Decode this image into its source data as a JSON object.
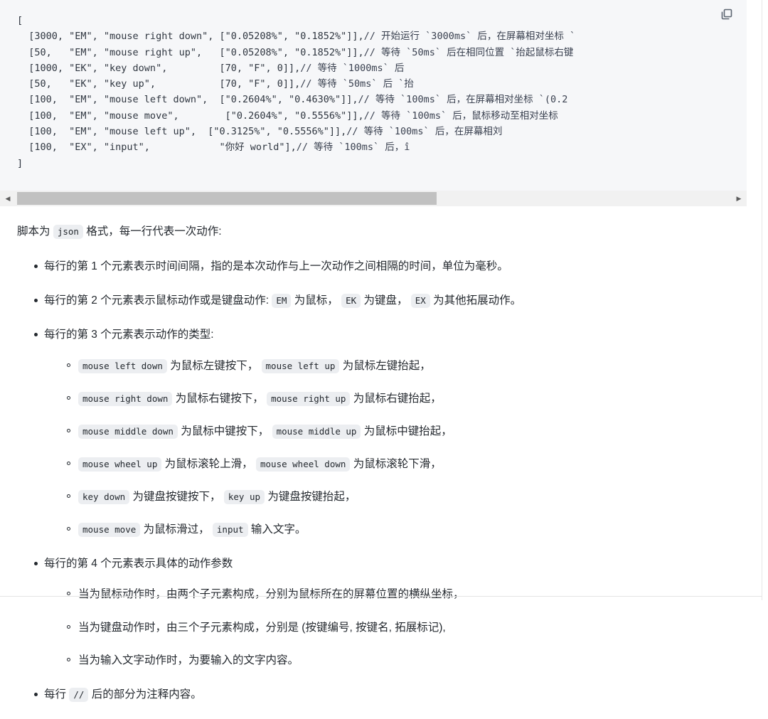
{
  "code_block": {
    "copy_icon": "copy-icon",
    "language": "json",
    "lines": [
      {
        "code": "[",
        "comment": ""
      },
      {
        "code": "  [3000, \"EM\", \"mouse right down\", [\"0.05208%\", \"0.1852%\"]],",
        "comment": "// 开始运行 `3000ms` 后，在屏幕相对坐标 `"
      },
      {
        "code": "  [50,   \"EM\", \"mouse right up\",   [\"0.05208%\", \"0.1852%\"]],",
        "comment": "// 等待 `50ms` 后在相同位置 `抬起鼠标右键"
      },
      {
        "code": "  [1000, \"EK\", \"key down\",         [70, \"F\", 0]],",
        "comment": "// 等待 `1000ms` 后 "
      },
      {
        "code": "  [50,   \"EK\", \"key up\",           [70, \"F\", 0]],",
        "comment": "// 等待 `50ms` 后 `抬"
      },
      {
        "code": "  [100,  \"EM\", \"mouse left down\",  [\"0.2604%\", \"0.4630%\"]],",
        "comment": "// 等待 `100ms` 后，在屏幕相对坐标 `(0.2"
      },
      {
        "code": "  [100,  \"EM\", \"mouse move\",        [\"0.2604%\", \"0.5556%\"]],",
        "comment": "// 等待 `100ms` 后，鼠标移动至相对坐标"
      },
      {
        "code": "  [100,  \"EM\", \"mouse left up\",  [\"0.3125%\", \"0.5556%\"]],",
        "comment": "// 等待 `100ms` 后，在屏幕相刘"
      },
      {
        "code": "  [100,  \"EX\", \"input\",            \"你好 world\"],",
        "comment": "// 等待 `100ms` 后，î"
      },
      {
        "code": "]",
        "comment": ""
      }
    ],
    "scrollbar": {
      "left_arrow": "◀",
      "right_arrow": "▶"
    }
  },
  "prose": {
    "intro": {
      "before": "脚本为",
      "code": "json",
      "after": "格式，每一行代表一次动作:"
    },
    "bullets": {
      "b1": "每行的第 1 个元素表示时间间隔，指的是本次动作与上一次动作之间相隔的时间，单位为毫秒。",
      "b2": {
        "lead": "每行的第 2 个元素表示鼠标动作或是键盘动作:",
        "c1": "EM",
        "t1": "为鼠标，",
        "c2": "EK",
        "t2": "为键盘，",
        "c3": "EX",
        "t3": "为其他拓展动作。"
      },
      "b3": {
        "lead": "每行的第 3 个元素表示动作的类型:",
        "subs": [
          {
            "c1": "mouse left down",
            "t1": "为鼠标左键按下，",
            "c2": "mouse left up",
            "t2": "为鼠标左键抬起，"
          },
          {
            "c1": "mouse right down",
            "t1": "为鼠标右键按下，",
            "c2": "mouse right up",
            "t2": "为鼠标右键抬起，"
          },
          {
            "c1": "mouse middle down",
            "t1": "为鼠标中键按下，",
            "c2": "mouse middle up",
            "t2": "为鼠标中键抬起，"
          },
          {
            "c1": "mouse wheel up",
            "t1": "为鼠标滚轮上滑，",
            "c2": "mouse wheel down",
            "t2": "为鼠标滚轮下滑，"
          },
          {
            "c1": "key down",
            "t1": "为键盘按键按下，",
            "c2": "key up",
            "t2": "为键盘按键抬起，"
          },
          {
            "c1": "mouse move",
            "t1": "为鼠标滑过，",
            "c2": "input",
            "t2": "输入文字。"
          }
        ]
      },
      "b4": {
        "lead": "每行的第 4 个元素表示具体的动作参数",
        "subs": [
          "当为鼠标动作时，由两个子元素构成，分别为鼠标所在的屏幕位置的横纵坐标，",
          "当为键盘动作时，由三个子元素构成，分别是 (按键编号, 按键名, 拓展标记),",
          "当为输入文字动作时，为要输入的文字内容。"
        ]
      },
      "b5": {
        "before": "每行",
        "code": "//",
        "after": "后的部分为注释内容。"
      }
    }
  },
  "colors": {
    "code_bg": "#f6f7f9",
    "code_text": "#2f3640",
    "inline_code_bg": "#eceef1",
    "body_text": "#24292f",
    "scrollbar_thumb": "#c1c1c1",
    "scrollbar_track": "#f1f1f1"
  }
}
